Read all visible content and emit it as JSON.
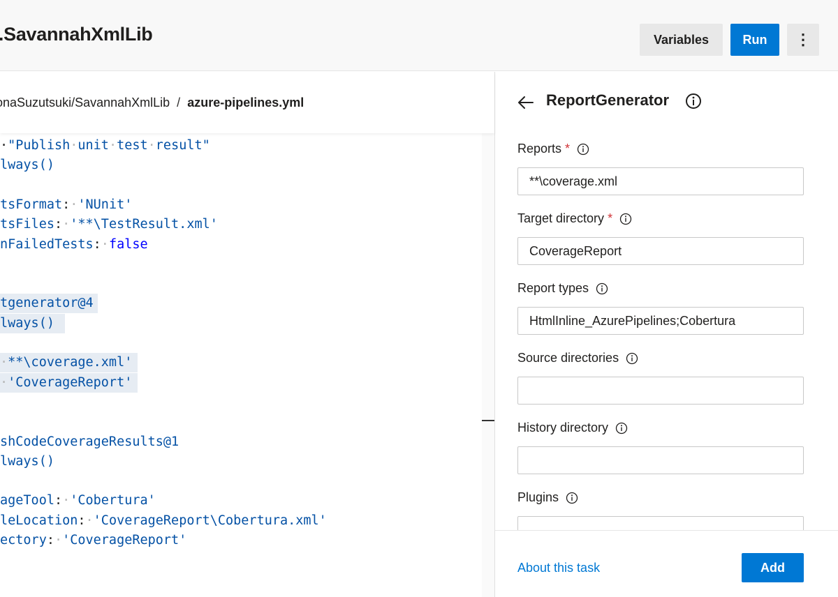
{
  "header": {
    "title": "ki.SavannahXmlLib",
    "variables_label": "Variables",
    "run_label": "Run",
    "more_label": "⋮"
  },
  "breadcrumb": {
    "repo": "onaSuzutsuki/SavannahXmlLib",
    "separator": "/",
    "file": "azure-pipelines.yml"
  },
  "editor": {
    "lines": [
      [
        [
          "p",
          "·"
        ],
        [
          "s",
          "\"Publish"
        ],
        [
          "d",
          "·"
        ],
        [
          "s",
          "unit"
        ],
        [
          "d",
          "·"
        ],
        [
          "s",
          "test"
        ],
        [
          "d",
          "·"
        ],
        [
          "s",
          "result\""
        ]
      ],
      [
        [
          "k",
          "lways()"
        ]
      ],
      [],
      [
        [
          "k",
          "tsFormat"
        ],
        [
          "p",
          ":"
        ],
        [
          "d",
          "·"
        ],
        [
          "s",
          "'NUnit'"
        ]
      ],
      [
        [
          "k",
          "tsFiles"
        ],
        [
          "p",
          ":"
        ],
        [
          "d",
          "·"
        ],
        [
          "s",
          "'**\\TestResult.xml'"
        ]
      ],
      [
        [
          "k",
          "nFailedTests"
        ],
        [
          "p",
          ":"
        ],
        [
          "d",
          "·"
        ],
        [
          "b",
          "false"
        ]
      ],
      [],
      [],
      [
        [
          "k",
          "tgenerator@4"
        ]
      ],
      [
        [
          "k",
          "lways()"
        ]
      ],
      [],
      [
        [
          "d",
          "·"
        ],
        [
          "s",
          "**\\coverage.xml'"
        ]
      ],
      [
        [
          "d",
          "·"
        ],
        [
          "s",
          "'CoverageReport'"
        ]
      ],
      [],
      [],
      [
        [
          "k",
          "shCodeCoverageResults@1"
        ]
      ],
      [
        [
          "k",
          "lways()"
        ]
      ],
      [],
      [
        [
          "k",
          "ageTool"
        ],
        [
          "p",
          ":"
        ],
        [
          "d",
          "·"
        ],
        [
          "s",
          "'Cobertura'"
        ]
      ],
      [
        [
          "k",
          "leLocation"
        ],
        [
          "p",
          ":"
        ],
        [
          "d",
          "·"
        ],
        [
          "s",
          "'CoverageReport\\Cobertura.xml'"
        ]
      ],
      [
        [
          "k",
          "ectory"
        ],
        [
          "p",
          ":"
        ],
        [
          "d",
          "·"
        ],
        [
          "s",
          "'CoverageReport'"
        ]
      ]
    ]
  },
  "panel": {
    "title": "ReportGenerator",
    "fields": [
      {
        "label": "Reports",
        "required": true,
        "value": "**\\coverage.xml"
      },
      {
        "label": "Target directory",
        "required": true,
        "value": "CoverageReport"
      },
      {
        "label": "Report types",
        "required": false,
        "value": "HtmlInline_AzurePipelines;Cobertura"
      },
      {
        "label": "Source directories",
        "required": false,
        "value": ""
      },
      {
        "label": "History directory",
        "required": false,
        "value": ""
      },
      {
        "label": "Plugins",
        "required": false,
        "value": ""
      }
    ],
    "required_marker": "*",
    "about_label": "About this task",
    "add_label": "Add"
  },
  "colors": {
    "accent": "#0078d4",
    "required": "#d13438",
    "code_key": "#0451a5",
    "code_bool": "#0000ff"
  }
}
